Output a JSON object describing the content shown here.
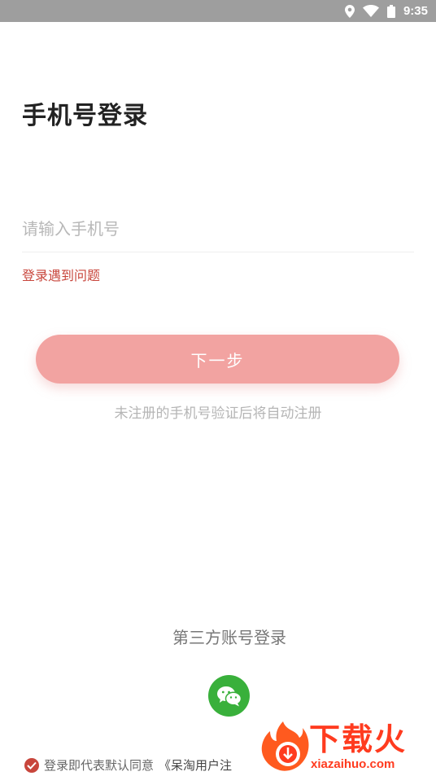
{
  "status_bar": {
    "time": "9:35",
    "icons": [
      "location-icon",
      "wifi-icon",
      "battery-icon"
    ]
  },
  "login": {
    "title": "手机号登录",
    "phone_placeholder": "请输入手机号",
    "phone_value": "",
    "trouble_link": "登录遇到问题",
    "next_button": "下一步",
    "auto_register_hint": "未注册的手机号验证后将自动注册"
  },
  "third_party": {
    "label": "第三方账号登录",
    "providers": [
      {
        "name": "wechat",
        "icon": "wechat-icon",
        "color": "#39b03b"
      }
    ]
  },
  "agreement": {
    "checked": true,
    "prefix": "登录即代表默认同意",
    "link": "《呆淘用户注"
  },
  "watermark": {
    "text": "下载火",
    "url": "xiazaihuo.com"
  },
  "colors": {
    "accent": "#c8463c",
    "button": "#f2a3a1",
    "status_bar": "#9e9e9e",
    "wechat": "#39b03b"
  }
}
